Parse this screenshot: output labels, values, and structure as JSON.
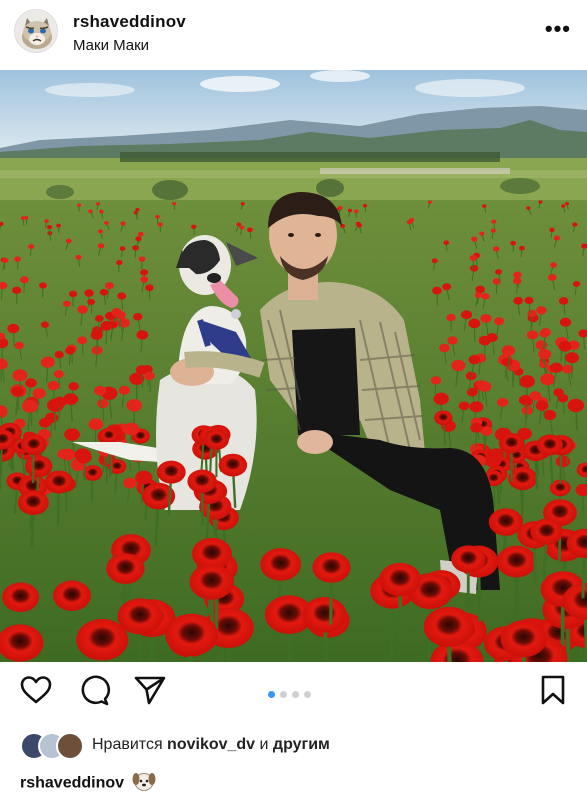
{
  "post": {
    "username": "rshaveddinov",
    "location": "Маки Маки",
    "more_label": "•••"
  },
  "photo": {
    "description_icon": "photo-poppy-field-man-with-dog"
  },
  "actions": {
    "like_icon": "heart-icon",
    "comment_icon": "comment-icon",
    "share_icon": "send-icon",
    "save_icon": "bookmark-icon"
  },
  "carousel": {
    "total": 4,
    "active": 1
  },
  "likes": {
    "prefix": "Нравится ",
    "user": "novikov_dv",
    "middle": " и ",
    "suffix": "другим"
  },
  "caption": {
    "username": "rshaveddinov",
    "emoji": "dog-face-emoji"
  },
  "colors": {
    "accent": "#3897f0",
    "poppy": "#d8140e",
    "text": "#111111"
  }
}
